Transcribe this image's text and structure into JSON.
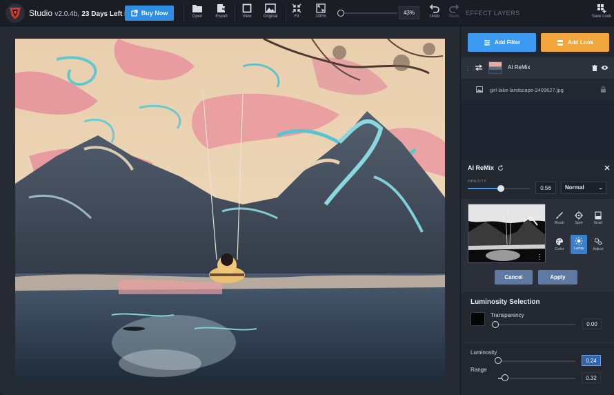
{
  "app": {
    "name": "Studio",
    "version": "v2.0.4b,",
    "trial": "23 Days Left in Trial",
    "buy_label": "Buy Now"
  },
  "toolbar": {
    "open": "Open",
    "export": "Export",
    "view": "View",
    "original": "Original",
    "fit": "Fit",
    "zoom100": "100%",
    "zoom_value": "43%",
    "zoom_level": 0.43,
    "undo": "Undo",
    "redo": "Redo",
    "effect_layers_title": "EFFECT LAYERS",
    "save_look": "Save Look"
  },
  "panel": {
    "add_filter": "Add Filter",
    "add_look": "Add Look",
    "layer_name": "AI ReMix",
    "source_file": "girl-lake-landscape-2409627.jpg",
    "filter_title": "AI ReMix",
    "opacity_label": "OPACITY",
    "opacity_value": "0.56",
    "blend_mode": "Normal",
    "tools": {
      "brush": "Brush",
      "spot": "Spot",
      "grad": "Grad",
      "color": "Color",
      "luma": "Luma",
      "adjust": "Adjust"
    },
    "cancel": "Cancel",
    "apply": "Apply",
    "luminosity_selection": "Luminosity Selection",
    "transparency_label": "Transparency",
    "transparency_value": "0.00",
    "luminosity_label": "Luminosity",
    "luminosity_value": "0.24",
    "range_label": "Range",
    "range_value": "0.32"
  },
  "colors": {
    "accent_blue": "#3d9af1",
    "accent_orange": "#f2a53a",
    "buy_blue": "#2f8de3",
    "logo_red": "#d9332b"
  }
}
